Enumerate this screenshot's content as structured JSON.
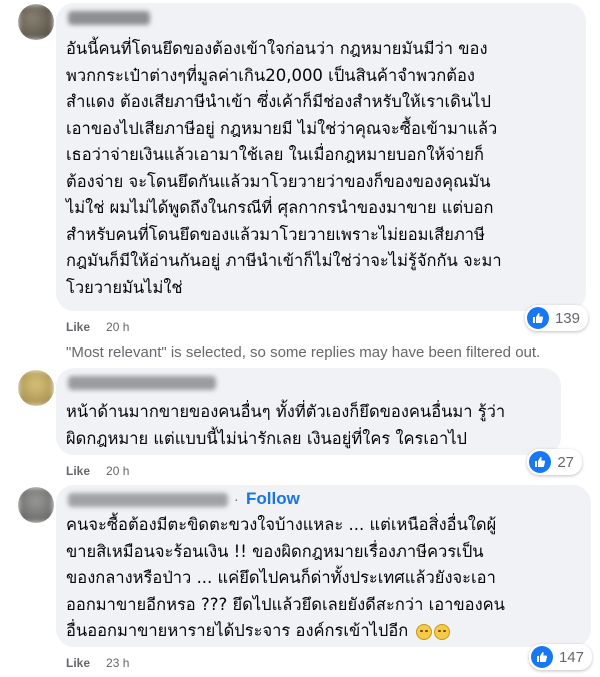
{
  "comments": [
    {
      "lines": [
        "อันนี้คนที่โดนยึดของต้องเข้าใจก่อนว่า กฎหมายมันมีว่า ของ",
        "พวกกระเป๋าต่างๆที่มูลค่าเกิน20,000 เป็นสินค้าจำพวกต้อง",
        "สำแดง ต้องเสียภาษีนำเข้า ซึ่งเค้าก็มีช่องสำหรับให้เราเดินไป",
        "เอาของไปเสียภาษีอยู่ กฎหมายมี ไม่ใช่ว่าคุณจะซื้อเข้ามาแล้ว",
        "เธอว่าจ่ายเงินแล้วเอามาใช้เลย ในเมื่อกฎหมายบอกให้จ่ายก็",
        "ต้องจ่าย จะโดนยึดกันแล้วมาโวยวายว่าของก็ของของคุณมัน",
        "ไม่ใช่ ผมไม่ได้พูดถึงในกรณีที่ ศุลกากรนำของมาขาย แต่บอก",
        "สำหรับคนที่โดนยึดของแล้วมาโวยวายเพราะไม่ยอมเสียภาษี",
        "กฎมันก็มีให้อ่านกันอยู่ ภาษีนำเข้าก็ไม่ใช่ว่าจะไม่รู้จักกัน จะมา",
        "โวยวายมันไม่ใช่"
      ],
      "like_label": "Like",
      "time": "20 h",
      "reaction_count": "139"
    },
    {
      "lines": [
        "หน้าด้านมากขายของคนอื่นๆ ทั้งที่ตัวเองก็ยึดของคนอื่นมา รู้ว่า",
        "ผิดกฎหมาย แต่แบบนี้ไม่น่ารักเลย เงินอยู่ที่ใคร ใครเอาไป"
      ],
      "like_label": "Like",
      "time": "20 h",
      "reaction_count": "27"
    },
    {
      "follow_label": "Follow",
      "dot": "·",
      "lines": [
        "คนจะซื้อต้องมีตะขิดตะขวงใจบ้างแหละ ... แต่เหนือสิ่งอื่นใดผู้",
        "ขายสิเหมือนจะร้อนเงิน !! ของผิดกฎหมายเรื่องภาษีควรเป็น",
        "ของกลางหรือป่าว ... แค่ยึดไปคนก็ด่าทั้งประเทศแล้วยังจะเอา",
        "ออกมาขายอีกหรอ ??? ยึดไปแล้วยึดเลยยังดีสะกว่า เอาของคน",
        "อื่นออกมาขายหารายได้ประจาร องค์กรเข้าไปอีก"
      ],
      "like_label": "Like",
      "time": "23 h",
      "reaction_count": "147"
    }
  ],
  "filter_note": "\"Most relevant\" is selected, so some replies may have been filtered out.",
  "colors": {
    "bubble": "#f0f2f5",
    "link_blue": "#1b74e4",
    "meta_gray": "#65676b",
    "like_blue": "#1877f2"
  },
  "icons": [
    "like-reaction-icon",
    "downcast-face-emoji"
  ]
}
